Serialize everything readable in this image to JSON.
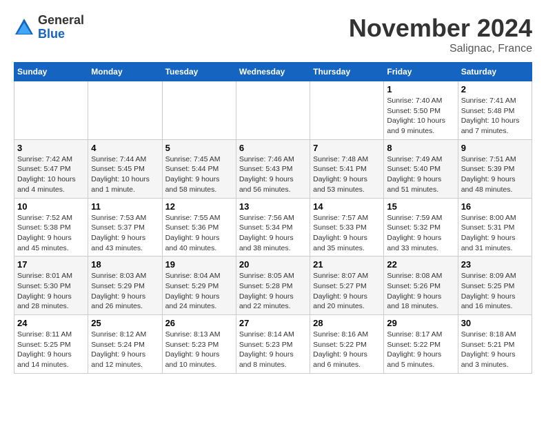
{
  "logo": {
    "general": "General",
    "blue": "Blue"
  },
  "header": {
    "month": "November 2024",
    "location": "Salignac, France"
  },
  "weekdays": [
    "Sunday",
    "Monday",
    "Tuesday",
    "Wednesday",
    "Thursday",
    "Friday",
    "Saturday"
  ],
  "weeks": [
    [
      {
        "day": "",
        "info": ""
      },
      {
        "day": "",
        "info": ""
      },
      {
        "day": "",
        "info": ""
      },
      {
        "day": "",
        "info": ""
      },
      {
        "day": "",
        "info": ""
      },
      {
        "day": "1",
        "info": "Sunrise: 7:40 AM\nSunset: 5:50 PM\nDaylight: 10 hours and 9 minutes."
      },
      {
        "day": "2",
        "info": "Sunrise: 7:41 AM\nSunset: 5:48 PM\nDaylight: 10 hours and 7 minutes."
      }
    ],
    [
      {
        "day": "3",
        "info": "Sunrise: 7:42 AM\nSunset: 5:47 PM\nDaylight: 10 hours and 4 minutes."
      },
      {
        "day": "4",
        "info": "Sunrise: 7:44 AM\nSunset: 5:45 PM\nDaylight: 10 hours and 1 minute."
      },
      {
        "day": "5",
        "info": "Sunrise: 7:45 AM\nSunset: 5:44 PM\nDaylight: 9 hours and 58 minutes."
      },
      {
        "day": "6",
        "info": "Sunrise: 7:46 AM\nSunset: 5:43 PM\nDaylight: 9 hours and 56 minutes."
      },
      {
        "day": "7",
        "info": "Sunrise: 7:48 AM\nSunset: 5:41 PM\nDaylight: 9 hours and 53 minutes."
      },
      {
        "day": "8",
        "info": "Sunrise: 7:49 AM\nSunset: 5:40 PM\nDaylight: 9 hours and 51 minutes."
      },
      {
        "day": "9",
        "info": "Sunrise: 7:51 AM\nSunset: 5:39 PM\nDaylight: 9 hours and 48 minutes."
      }
    ],
    [
      {
        "day": "10",
        "info": "Sunrise: 7:52 AM\nSunset: 5:38 PM\nDaylight: 9 hours and 45 minutes."
      },
      {
        "day": "11",
        "info": "Sunrise: 7:53 AM\nSunset: 5:37 PM\nDaylight: 9 hours and 43 minutes."
      },
      {
        "day": "12",
        "info": "Sunrise: 7:55 AM\nSunset: 5:36 PM\nDaylight: 9 hours and 40 minutes."
      },
      {
        "day": "13",
        "info": "Sunrise: 7:56 AM\nSunset: 5:34 PM\nDaylight: 9 hours and 38 minutes."
      },
      {
        "day": "14",
        "info": "Sunrise: 7:57 AM\nSunset: 5:33 PM\nDaylight: 9 hours and 35 minutes."
      },
      {
        "day": "15",
        "info": "Sunrise: 7:59 AM\nSunset: 5:32 PM\nDaylight: 9 hours and 33 minutes."
      },
      {
        "day": "16",
        "info": "Sunrise: 8:00 AM\nSunset: 5:31 PM\nDaylight: 9 hours and 31 minutes."
      }
    ],
    [
      {
        "day": "17",
        "info": "Sunrise: 8:01 AM\nSunset: 5:30 PM\nDaylight: 9 hours and 28 minutes."
      },
      {
        "day": "18",
        "info": "Sunrise: 8:03 AM\nSunset: 5:29 PM\nDaylight: 9 hours and 26 minutes."
      },
      {
        "day": "19",
        "info": "Sunrise: 8:04 AM\nSunset: 5:29 PM\nDaylight: 9 hours and 24 minutes."
      },
      {
        "day": "20",
        "info": "Sunrise: 8:05 AM\nSunset: 5:28 PM\nDaylight: 9 hours and 22 minutes."
      },
      {
        "day": "21",
        "info": "Sunrise: 8:07 AM\nSunset: 5:27 PM\nDaylight: 9 hours and 20 minutes."
      },
      {
        "day": "22",
        "info": "Sunrise: 8:08 AM\nSunset: 5:26 PM\nDaylight: 9 hours and 18 minutes."
      },
      {
        "day": "23",
        "info": "Sunrise: 8:09 AM\nSunset: 5:25 PM\nDaylight: 9 hours and 16 minutes."
      }
    ],
    [
      {
        "day": "24",
        "info": "Sunrise: 8:11 AM\nSunset: 5:25 PM\nDaylight: 9 hours and 14 minutes."
      },
      {
        "day": "25",
        "info": "Sunrise: 8:12 AM\nSunset: 5:24 PM\nDaylight: 9 hours and 12 minutes."
      },
      {
        "day": "26",
        "info": "Sunrise: 8:13 AM\nSunset: 5:23 PM\nDaylight: 9 hours and 10 minutes."
      },
      {
        "day": "27",
        "info": "Sunrise: 8:14 AM\nSunset: 5:23 PM\nDaylight: 9 hours and 8 minutes."
      },
      {
        "day": "28",
        "info": "Sunrise: 8:16 AM\nSunset: 5:22 PM\nDaylight: 9 hours and 6 minutes."
      },
      {
        "day": "29",
        "info": "Sunrise: 8:17 AM\nSunset: 5:22 PM\nDaylight: 9 hours and 5 minutes."
      },
      {
        "day": "30",
        "info": "Sunrise: 8:18 AM\nSunset: 5:21 PM\nDaylight: 9 hours and 3 minutes."
      }
    ]
  ]
}
